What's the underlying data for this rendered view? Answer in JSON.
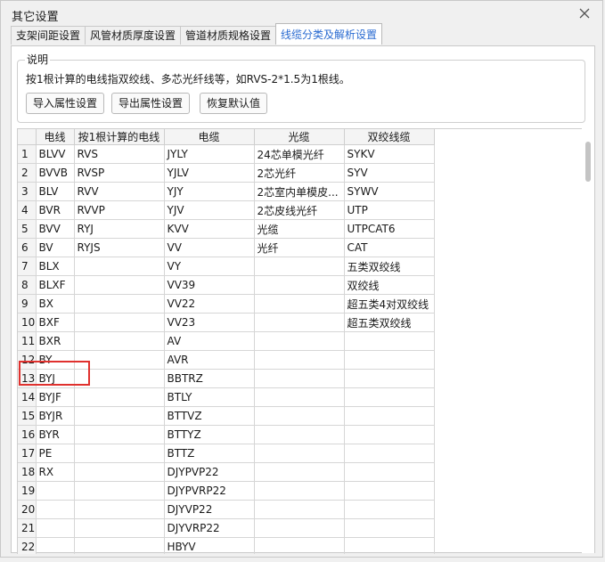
{
  "window": {
    "title": "其它设置"
  },
  "tabs": [
    {
      "label": "支架间距设置"
    },
    {
      "label": "风管材质厚度设置"
    },
    {
      "label": "管道材质规格设置"
    },
    {
      "label": "线缆分类及解析设置"
    }
  ],
  "active_tab": 3,
  "group": {
    "label": "说明",
    "description": "按1根计算的电线指双绞线、多芯光纤线等，如RVS-2*1.5为1根线。",
    "buttons": [
      {
        "label": "导入属性设置"
      },
      {
        "label": "导出属性设置"
      },
      {
        "label": "恢复默认值"
      }
    ]
  },
  "table": {
    "headers": [
      "",
      "电线",
      "按1根计算的电线",
      "电缆",
      "光缆",
      "双绞线缆"
    ],
    "rows": [
      [
        "1",
        "BLVV",
        "RVS",
        "JYLY",
        "24芯单模光纤",
        "SYKV"
      ],
      [
        "2",
        "BVVB",
        "RVSP",
        "YJLV",
        "2芯光纤",
        "SYV"
      ],
      [
        "3",
        "BLV",
        "RVV",
        "YJY",
        "2芯室内单模皮...",
        "SYWV"
      ],
      [
        "4",
        "BVR",
        "RVVP",
        "YJV",
        "2芯皮线光纤",
        "UTP"
      ],
      [
        "5",
        "BVV",
        "RYJ",
        "KVV",
        "光缆",
        "UTPCAT6"
      ],
      [
        "6",
        "BV",
        "RYJS",
        "VV",
        "光纤",
        "CAT"
      ],
      [
        "7",
        "BLX",
        "",
        "VY",
        "",
        "五类双绞线"
      ],
      [
        "8",
        "BLXF",
        "",
        "VV39",
        "",
        "双绞线"
      ],
      [
        "9",
        "BX",
        "",
        "VV22",
        "",
        "超五类4对双绞线"
      ],
      [
        "10",
        "BXF",
        "",
        "VV23",
        "",
        "超五类双绞线"
      ],
      [
        "11",
        "BXR",
        "",
        "AV",
        "",
        ""
      ],
      [
        "12",
        "BY",
        "",
        "AVR",
        "",
        ""
      ],
      [
        "13",
        "BYJ",
        "",
        "BBTRZ",
        "",
        ""
      ],
      [
        "14",
        "BYJF",
        "",
        "BTLY",
        "",
        ""
      ],
      [
        "15",
        "BYJR",
        "",
        "BTTVZ",
        "",
        ""
      ],
      [
        "16",
        "BYR",
        "",
        "BTTYZ",
        "",
        ""
      ],
      [
        "17",
        "PE",
        "",
        "BTTZ",
        "",
        ""
      ],
      [
        "18",
        "RX",
        "",
        "DJYPVP22",
        "",
        ""
      ],
      [
        "19",
        "",
        "",
        "DJYPVRP22",
        "",
        ""
      ],
      [
        "20",
        "",
        "",
        "DJYVP22",
        "",
        ""
      ],
      [
        "21",
        "",
        "",
        "DJYVRP22",
        "",
        ""
      ],
      [
        "22",
        "",
        "",
        "HBYV",
        "",
        ""
      ]
    ]
  },
  "colors": {
    "accent": "#2a6bd1",
    "highlight": "#e0312e"
  }
}
